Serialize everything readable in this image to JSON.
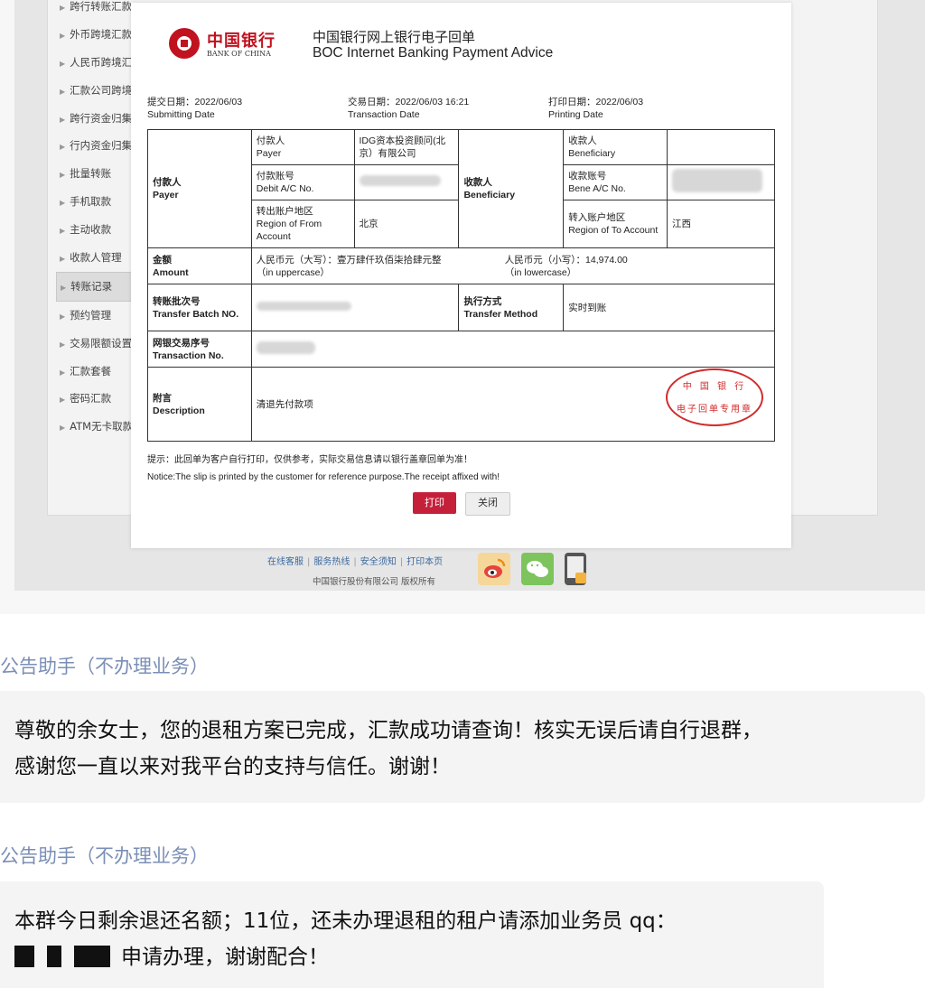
{
  "sidebar": {
    "items": [
      {
        "label": "跨行转账汇款"
      },
      {
        "label": "外币跨境汇款"
      },
      {
        "label": "人民币跨境汇款"
      },
      {
        "label": "汇款公司跨境汇款"
      },
      {
        "label": "跨行资金归集"
      },
      {
        "label": "行内资金归集"
      },
      {
        "label": "批量转账"
      },
      {
        "label": "手机取款"
      },
      {
        "label": "主动收款"
      },
      {
        "label": "收款人管理"
      },
      {
        "label": "转账记录",
        "active": true
      },
      {
        "label": "预约管理"
      },
      {
        "label": "交易限额设置"
      },
      {
        "label": "汇款套餐"
      },
      {
        "label": "密码汇款"
      },
      {
        "label": "ATM无卡取款"
      }
    ]
  },
  "footer": {
    "links": [
      "在线客服",
      "服务热线",
      "安全须知",
      "打印本页"
    ],
    "copyright": "中国银行股份有限公司  版权所有",
    "icons": [
      "weibo-icon",
      "wechat-icon",
      "mobile-icon"
    ]
  },
  "advice": {
    "logo_cn": "中国银行",
    "logo_en": "BANK OF CHINA",
    "title_cn": "中国银行网上银行电子回单",
    "title_en": "BOC Internet Banking Payment Advice",
    "submit": {
      "label": "提交日期：2022/06/03",
      "en": "Submitting Date"
    },
    "trans": {
      "label": "交易日期：2022/06/03 16:21",
      "en": "Transaction Date"
    },
    "print": {
      "label": "打印日期：2022/06/03",
      "en": "Printing Date"
    },
    "payer": {
      "label_cn": "付款人",
      "label_en": "Payer",
      "name_label": "付款人",
      "name_label_en": "Payer",
      "name_value": "IDG资本投资顾问(北京）有限公司",
      "acct_label": "付款账号",
      "acct_label_en": "Debit A/C No.",
      "region_label": "转出账户地区",
      "region_label_en": "Region of From Account",
      "region_value": "北京"
    },
    "beneficiary": {
      "label_cn": "收款人",
      "label_en": "Beneficiary",
      "name_label": "收款人",
      "name_label_en": "Beneficiary",
      "acct_label": "收款账号",
      "acct_label_en": "Bene A/C No.",
      "region_label": "转入账户地区",
      "region_label_en": "Region of To Account",
      "region_value": "江西"
    },
    "amount": {
      "label_cn": "金额",
      "label_en": "Amount",
      "upper": "人民币元（大写）：壹万肆仟玖佰柒拾肆元整",
      "upper_en": "（in uppercase）",
      "lower": "人民币元（小写）：14,974.00",
      "lower_en": "（in lowercase）"
    },
    "batch": {
      "label_cn": "转账批次号",
      "label_en": "Transfer Batch NO."
    },
    "method": {
      "label_cn": "执行方式",
      "label_en": "Transfer Method",
      "value": "实时到账"
    },
    "txn_no": {
      "label_cn": "网银交易序号",
      "label_en": "Transaction No."
    },
    "desc": {
      "label_cn": "附言",
      "label_en": "Description",
      "value": "清退先付款项"
    },
    "stamp": {
      "top": "中 国 银 行",
      "bottom": "电子回单专用章"
    },
    "notice_cn": "提示：此回单为客户自行打印，仅供参考，实际交易信息请以银行盖章回单为准！",
    "notice_en": "Notice:The slip is printed by the customer for reference purpose.The receipt affixed with!",
    "print_button": "打印",
    "close_button": "关闭"
  },
  "chat": [
    {
      "sender": "公告助手（不办理业务）",
      "lines": [
        "尊敬的余女士，您的退租方案已完成，汇款成功请查询！核实无误后请自行退群，",
        "感谢您一直以来对我平台的支持与信任。谢谢！"
      ]
    },
    {
      "sender": "公告助手（不办理业务）",
      "line1": "本群今日剩余退还名额；11位，还未办理退租的租户请添加业务员  qq：",
      "line2": "申请办理，谢谢配合！"
    }
  ]
}
